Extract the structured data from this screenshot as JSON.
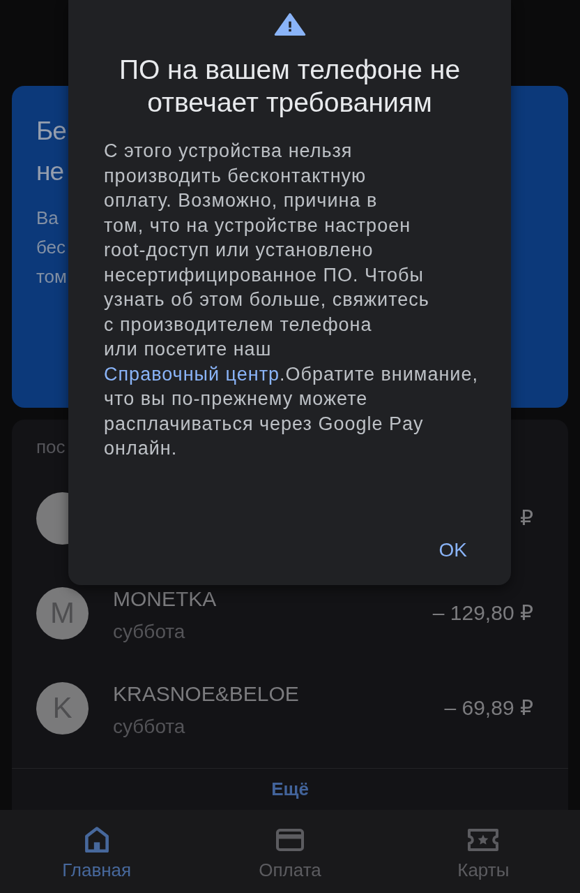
{
  "promo_card": {
    "title_lines": [
      "Бе",
      "не"
    ],
    "text_lines": [
      "Ва",
      "бес",
      "том"
    ]
  },
  "transactions": {
    "heading": "пос",
    "rows": [
      {
        "amount": "₽"
      },
      {
        "letter": "M",
        "merchant": "MONETKA",
        "date": "суббота",
        "amount": "– 129,80 ₽"
      },
      {
        "letter": "K",
        "merchant": "KRASNOE&BELOE",
        "date": "суббота",
        "amount": "– 69,89 ₽"
      }
    ],
    "more_button": "Ещё"
  },
  "nav": {
    "items": [
      {
        "kind": "home",
        "label": "Главная",
        "selected": true
      },
      {
        "kind": "card",
        "label": "Оплата",
        "selected": false
      },
      {
        "kind": "tickets",
        "label": "Карты",
        "selected": false
      }
    ]
  },
  "dialog": {
    "title": "ПО на вашем телефоне не отвечает требованиям",
    "message": {
      "before_link": "С этого устройства нельзя\nпроизводить бесконтактную\nоплату. Возможно, причина в\nтом, что на устройстве настроен\nroot-доступ или установлено\nнесертифицированное ПО. Чтобы\nузнать об этом больше, свяжитесь\nс производителем телефона\nили посетите наш ",
      "link": "Справочный центр",
      "after_link": ".Обратите внимание,\nчто вы по-прежнему можете\nрасплачиваться через Google Pay\nонлайн."
    },
    "button": "OK"
  }
}
